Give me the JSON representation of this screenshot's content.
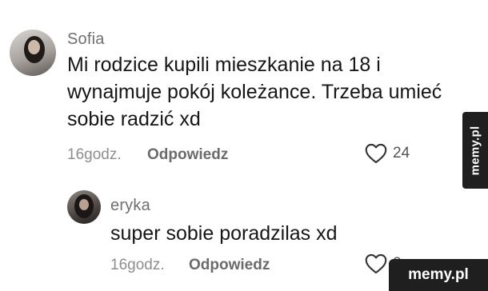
{
  "comments": [
    {
      "username": "Sofia",
      "text": "Mi rodzice kupili mieszkanie na 18 i\nwynajmuje pokój koleżance. Trzeba umieć\nsobie radzić xd",
      "time": "16godz.",
      "reply_label": "Odpowiedz",
      "likes": "24"
    },
    {
      "username": "eryka",
      "text": "super sobie poradzilas xd",
      "time": "16godz.",
      "reply_label": "Odpowiedz",
      "likes": "2"
    }
  ],
  "watermarks": {
    "side": "memy.pl",
    "corner": "memy.pl"
  },
  "icons": {
    "like": "heart-outline-icon"
  }
}
